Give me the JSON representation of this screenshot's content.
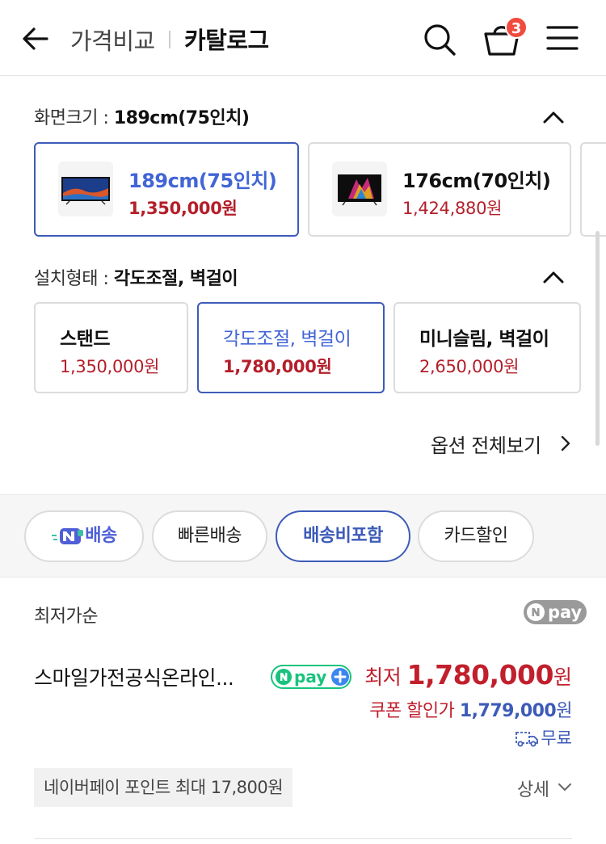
{
  "header": {
    "title_section": "가격비교",
    "title_page": "카탈로그",
    "cart_count": "3",
    "icons": [
      "back-arrow-icon",
      "search-icon",
      "cart-icon",
      "menu-icon"
    ]
  },
  "screen_size": {
    "label": "화면크기 : ",
    "selected": "189cm(75인치)",
    "options": [
      {
        "name": "189cm(75인치)",
        "price": "1,350,000원",
        "selected": true
      },
      {
        "name": "176cm(70인치)",
        "price": "1,424,880원",
        "selected": false
      }
    ]
  },
  "install_type": {
    "label": "설치형태 : ",
    "selected": "각도조절, 벽걸이",
    "options": [
      {
        "name": "스탠드",
        "price": "1,350,000원",
        "selected": false
      },
      {
        "name": "각도조절, 벽걸이",
        "price": "1,780,000원",
        "selected": true
      },
      {
        "name": "미니슬림, 벽걸이",
        "price": "2,650,000원",
        "selected": false
      }
    ]
  },
  "see_all": "옵션 전체보기",
  "filters": {
    "chips": [
      {
        "label": "배송",
        "brand": "N",
        "selected": false
      },
      {
        "label": "빠른배송",
        "selected": false
      },
      {
        "label": "배송비포함",
        "selected": true
      },
      {
        "label": "카드할인",
        "selected": false
      }
    ]
  },
  "list": {
    "sort_label": "최저가순",
    "npay_label": "pay",
    "item": {
      "seller": "스마일가전공식온라인...",
      "npay_plus_label": "pay",
      "lowest_label": "최저 ",
      "lowest_value": "1,780,000",
      "lowest_unit": "원",
      "coupon_label": "쿠폰 할인가 ",
      "coupon_value": "1,779,000",
      "coupon_unit": "원",
      "shipping": "무료",
      "points": "네이버페이 포인트 최대 17,800원",
      "detail": "상세"
    }
  },
  "colors": {
    "accent_blue": "#3d5bb8",
    "price_red": "#b31f2a",
    "badge_red": "#f04b3e",
    "npay_green": "#19c37d"
  }
}
